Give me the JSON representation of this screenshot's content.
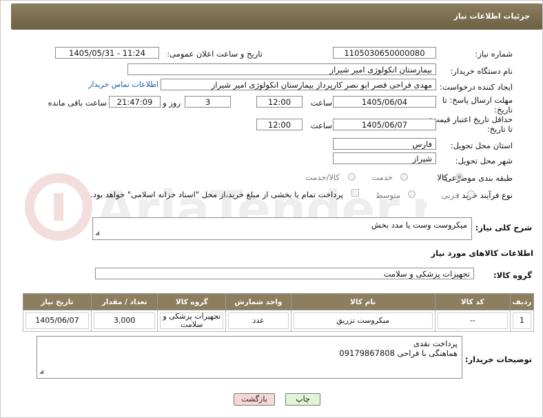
{
  "header": {
    "title": "جزئیات اطلاعات نیاز"
  },
  "watermark_text": "AriaTender.net",
  "form": {
    "need_number_label": "شماره نیاز:",
    "need_number": "1105030650000080",
    "announce_label": "تاریخ و ساعت اعلان عمومی:",
    "announce_value": "1405/05/31 - 11:24",
    "buyer_org_label": "نام دستگاه خریدار:",
    "buyer_org": "بیمارستان انکولوژی امیر شیراز",
    "creator_label": "ایجاد کننده درخواست:",
    "creator": "مهدی فراحی قصر ابو نصر کارپرداز بیمارستان انکولوژی امیر شیراز",
    "contact_link": "اطلاعات تماس خریدار",
    "deadline_label": "مهلت ارسال پاسخ: تا تاریخ:",
    "deadline_date": "1405/06/04",
    "time_label": "ساعت",
    "deadline_time": "12:00",
    "days_value": "3",
    "days_label": "روز و",
    "remaining_value": "21:47:09",
    "remaining_label": "ساعت باقی مانده",
    "validity_label": "حداقل تاریخ اعتبار قیمت: تا تاریخ:",
    "validity_date": "1405/06/07",
    "validity_time": "12:00",
    "province_label": "استان محل تحویل:",
    "province": "فارس",
    "city_label": "شهر محل تحویل:",
    "city": "شیراز",
    "category_label": "طبقه بندی موضوعی:",
    "category_options": [
      "کالا",
      "خدمت",
      "کالا/خدمت"
    ],
    "process_label": "نوع فرآیند خرید :",
    "process_options": [
      "جزیی",
      "متوسط"
    ],
    "payment_note": "پرداخت تمام یا بخشی از مبلغ خرید،از محل \"اسناد خزانه اسلامی\" خواهد بود."
  },
  "summary": {
    "label": "شرح کلی نیاز:",
    "value": "میکروست وست یا مدد بخش"
  },
  "goods_section_title": "اطلاعات کالاهای مورد نیاز",
  "goods_group": {
    "label": "گروه کالا:",
    "value": "تجهیزات پزشکی و سلامت"
  },
  "table": {
    "headers": [
      "ردیف",
      "کد کالا",
      "نام کالا",
      "واحد شمارش",
      "گروه کالا",
      "تعداد / مقدار",
      "تاریخ نیاز"
    ],
    "rows": [
      [
        "1",
        "--",
        "میکروست تزریق",
        "عدد",
        "تجهیزات پزشکی و سلامت",
        "3,000",
        "1405/06/07"
      ]
    ]
  },
  "buyer_notes": {
    "label": "توضیحات خریدار:",
    "line1": "پرداخت نقدی",
    "line2": "هماهنگی با فراحی 09179867808"
  },
  "buttons": {
    "print": "چاپ",
    "back": "بازگشت"
  },
  "colors": {
    "header_bg": "#8c7e5f",
    "link": "#1a56b3",
    "print_btn": "#dff5d6",
    "back_btn": "#f7d6d6"
  }
}
